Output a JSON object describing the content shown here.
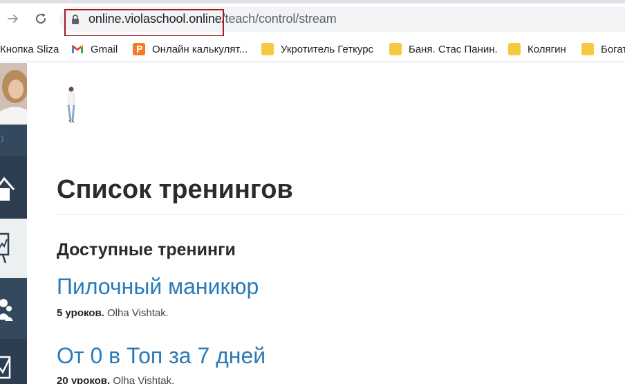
{
  "browser": {
    "url_host": "online.violaschool.online",
    "url_path": "/teach/control/stream"
  },
  "bookmarks": [
    {
      "label": "Кнопка Sliza",
      "icon": "none"
    },
    {
      "label": "Gmail",
      "icon": "gmail-icon"
    },
    {
      "label": "Онлайн калькулят...",
      "icon": "calculator-icon"
    },
    {
      "label": "Укротитель Геткурс",
      "icon": "folder-icon"
    },
    {
      "label": "Баня. Стас Панин.",
      "icon": "folder-icon"
    },
    {
      "label": "Колягин",
      "icon": "folder-icon"
    },
    {
      "label": "Богат",
      "icon": "folder-icon"
    }
  ],
  "sidebar": {
    "items": [
      "home-icon",
      "chart-board-icon",
      "users-icon",
      "checkbox-icon"
    ]
  },
  "page": {
    "title": "Список тренингов",
    "section_title": "Доступные тренинги"
  },
  "trainings": [
    {
      "title": "Пилочный маникюр",
      "lessons": "5 уроков.",
      "author": "Olha Vishtak."
    },
    {
      "title": "От 0 в Топ за 7 дней",
      "lessons": "20 уроков.",
      "author": "Olha Vishtak."
    }
  ],
  "colors": {
    "sidebar_bg": "#2c3e50",
    "link_blue": "#2a7ab8",
    "highlight_red": "#a8171f"
  }
}
